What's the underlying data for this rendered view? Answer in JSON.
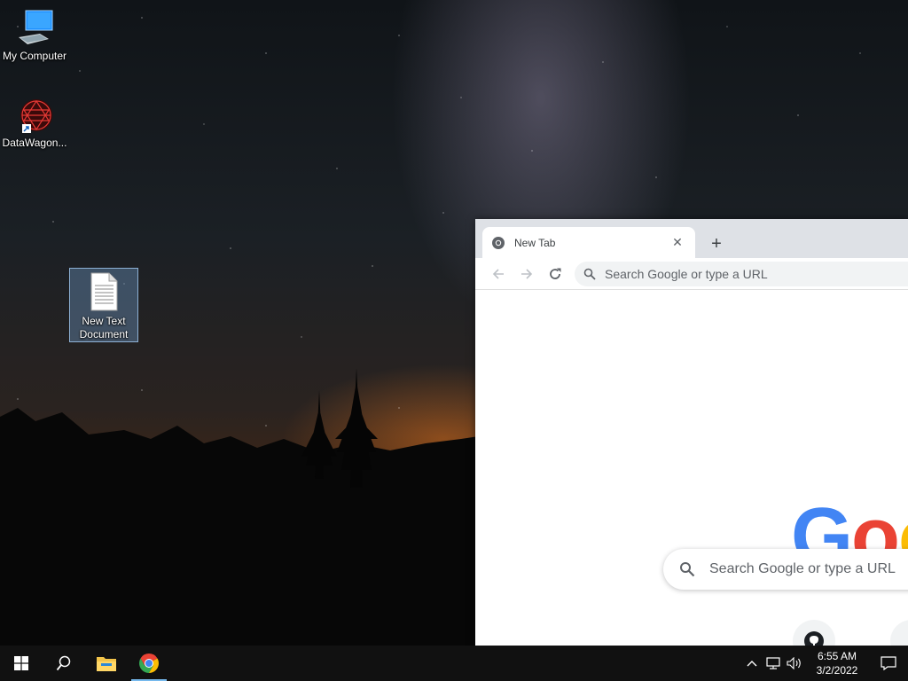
{
  "desktop": {
    "icons": [
      {
        "label": "My Computer"
      },
      {
        "label": "DataWagon..."
      },
      {
        "label": "New Text Document"
      }
    ]
  },
  "browser": {
    "tab_title": "New Tab",
    "tab_close": "✕",
    "new_tab": "+",
    "omnibox_placeholder": "Search Google or type a URL",
    "ntp_search_placeholder": "Search Google or type a URL",
    "logo_letters": [
      "G",
      "o",
      "o"
    ]
  },
  "taskbar": {
    "time": "6:55 AM",
    "date": "3/2/2022"
  },
  "colors": {
    "google_blue": "#4285f4",
    "google_red": "#ea4335",
    "google_yellow": "#fbbc05",
    "taskbar_accent": "#76b9ed"
  },
  "icons": [
    "windows-start-icon",
    "search-icon",
    "file-explorer-icon",
    "chrome-icon",
    "chevron-up-icon",
    "network-icon",
    "volume-icon",
    "notification-icon",
    "github-icon"
  ]
}
